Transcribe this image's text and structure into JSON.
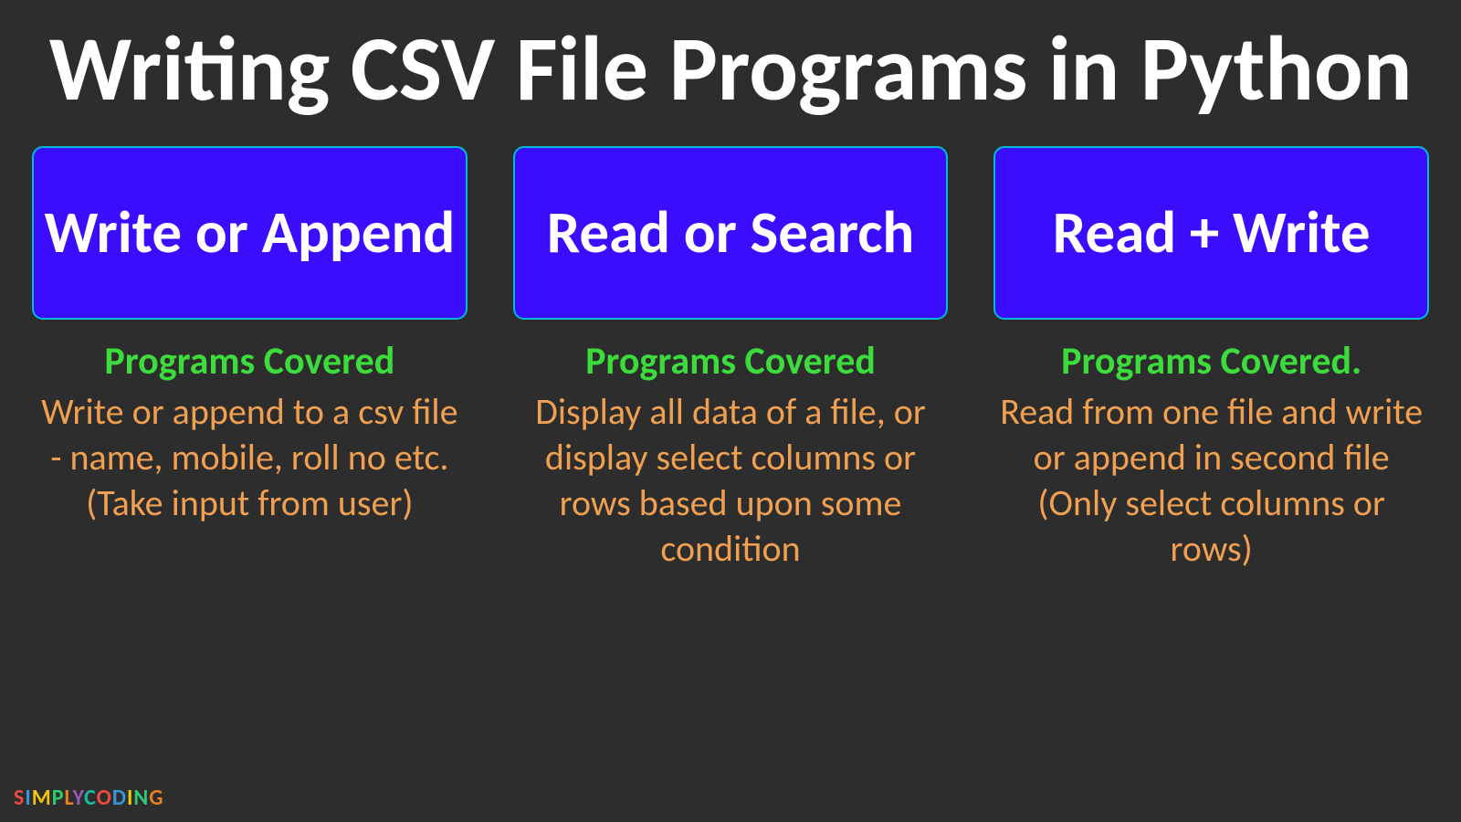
{
  "title": "Writing CSV File Programs in Python",
  "columns": [
    {
      "heading": "Write or Append",
      "subtitle": "Programs Covered",
      "description": "Write or append to a csv file  - name, mobile, roll no etc. (Take input from user)"
    },
    {
      "heading": "Read or Search",
      "subtitle": "Programs Covered",
      "description": "Display all data of a file, or display select columns or rows based upon some condition"
    },
    {
      "heading": "Read + Write",
      "subtitle": "Programs Covered.",
      "description": "Read from one file and write or append in second file (Only select columns or rows)"
    }
  ],
  "logo": "SIMPLYCODING"
}
